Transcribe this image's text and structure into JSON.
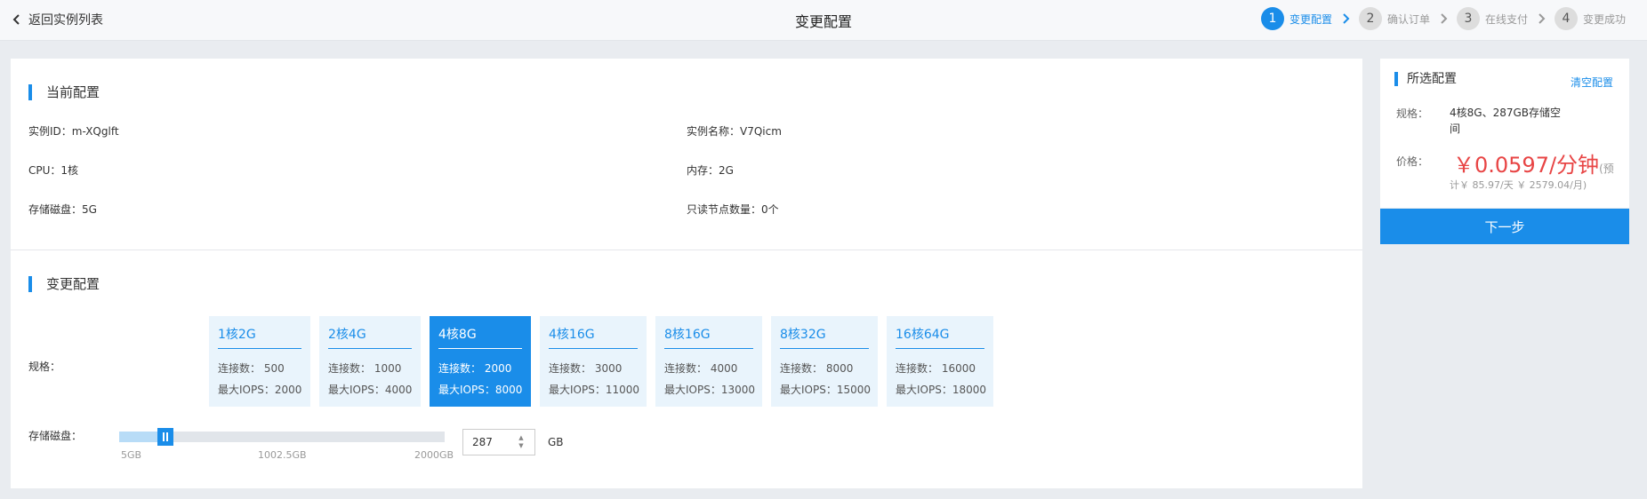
{
  "topbar": {
    "back_label": "返回实例列表",
    "title": "变更配置",
    "steps": [
      {
        "num": "1",
        "label": "变更配置",
        "active": true
      },
      {
        "num": "2",
        "label": "确认订单",
        "active": false
      },
      {
        "num": "3",
        "label": "在线支付",
        "active": false
      },
      {
        "num": "4",
        "label": "变更成功",
        "active": false
      }
    ]
  },
  "current": {
    "title": "当前配置",
    "instance_id": "实例ID：m-XQglft",
    "instance_name": "实例名称：V7Qicm",
    "cpu": "CPU：1核",
    "memory": "内存：2G",
    "disk": "存储磁盘：5G",
    "readonly_nodes": "只读节点数量：0个"
  },
  "change": {
    "title": "变更配置",
    "spec_label": "规格：",
    "disk_label": "存储磁盘：",
    "specs": [
      {
        "name": "1核2G",
        "conn": "连接数：  500",
        "iops": "最大IOPS：2000",
        "selected": false
      },
      {
        "name": "2核4G",
        "conn": "连接数：  1000",
        "iops": "最大IOPS：4000",
        "selected": false
      },
      {
        "name": "4核8G",
        "conn": "连接数：  2000",
        "iops": "最大IOPS：8000",
        "selected": true
      },
      {
        "name": "4核16G",
        "conn": "连接数：  3000",
        "iops": "最大IOPS：11000",
        "selected": false
      },
      {
        "name": "8核16G",
        "conn": "连接数：  4000",
        "iops": "最大IOPS：13000",
        "selected": false
      },
      {
        "name": "8核32G",
        "conn": "连接数：  8000",
        "iops": "最大IOPS：15000",
        "selected": false
      },
      {
        "name": "16核64G",
        "conn": "连接数：  16000",
        "iops": "最大IOPS：18000",
        "selected": false
      }
    ],
    "slider": {
      "min": 5,
      "max": 2000,
      "value": 287,
      "tick_min": "5GB",
      "tick_mid": "1002.5GB",
      "tick_max": "2000GB"
    },
    "disk_value": "287",
    "disk_unit": "GB"
  },
  "summary": {
    "title": "所选配置",
    "clear_label": "清空配置",
    "spec_key": "规格：",
    "spec_val": "4核8G、287GB存储空间",
    "price_key": "价格：",
    "price": "￥0.0597/分钟",
    "price_paren": "(预",
    "price_sub": "计￥ 85.97/天 ￥ 2579.04/月)",
    "next_label": "下一步"
  },
  "colors": {
    "accent": "#1a8de9",
    "price": "#e84545"
  }
}
